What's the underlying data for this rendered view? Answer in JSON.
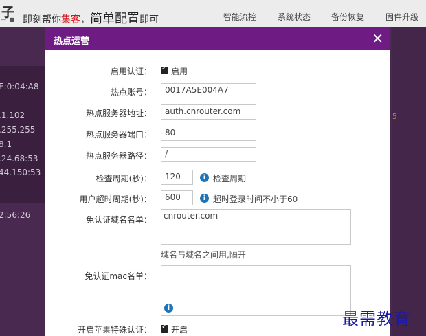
{
  "header": {
    "logo_glyph": "子",
    "logo_sub": "— ■",
    "slogan_pre": "即刻帮你",
    "slogan_highlight": "集客",
    "slogan_mid": "，",
    "slogan_big": "简单配置",
    "slogan_post": "即可",
    "nav": [
      "智能流控",
      "系统状态",
      "备份恢复",
      "固件升级"
    ]
  },
  "background_text": [
    "E:0:04:A8",
    ".1.102",
    ".255.255",
    "8.1",
    ".24.68:53",
    "44.150:53",
    "",
    "2:56:26"
  ],
  "modal": {
    "title": "热点运营",
    "close_glyph": "✕",
    "fields": {
      "enable_auth_label": "启用认证：",
      "enable_auth_checkbox_label": "启用",
      "enable_auth_checked": true,
      "hotspot_account_label": "热点账号：",
      "hotspot_account_value": "0017A5E004A7",
      "server_address_label": "热点服务器地址：",
      "server_address_value": "auth.cnrouter.com",
      "server_port_label": "热点服务器端口：",
      "server_port_value": "80",
      "server_path_label": "热点服务器路径：",
      "server_path_value": "/",
      "check_period_label": "检查周期(秒)：",
      "check_period_value": "120",
      "check_period_hint": "检查周期",
      "user_timeout_label": "用户超时周期(秒)：",
      "user_timeout_value": "600",
      "user_timeout_hint": "超时登录时间不小于60",
      "domain_whitelist_label": "免认证域名名单：",
      "domain_whitelist_value": "cnrouter.com",
      "domain_whitelist_hint": "域名与域名之间用,隔开",
      "mac_whitelist_label": "免认证mac名单：",
      "mac_whitelist_value": "",
      "apple_auth_label": "开启苹果特殊认证：",
      "apple_auth_checkbox_label": "开启",
      "apple_auth_checked": true
    }
  },
  "watermark": "最需教育",
  "colors": {
    "modal_header": "#6e1c84",
    "info_icon": "#1e74b8",
    "slogan_highlight": "#d2141c"
  }
}
